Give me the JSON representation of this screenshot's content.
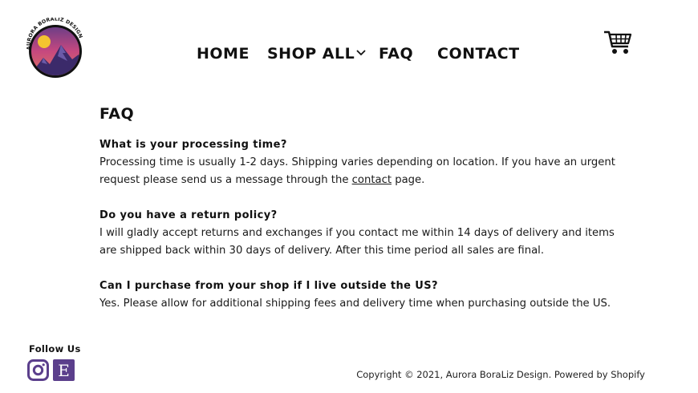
{
  "brand": {
    "logo_text": "AURORA BORALIZ DESIGN",
    "logo_colors": {
      "ring": "#111111",
      "sky_top": "#5b3f8c",
      "sky_mid": "#c6487f",
      "sun": "#f4c430",
      "mountain": "#3b2a6a"
    }
  },
  "nav": {
    "items": [
      {
        "label": "HOME"
      },
      {
        "label": "SHOP ALL"
      },
      {
        "label": "FAQ"
      },
      {
        "label": "CONTACT"
      }
    ],
    "cart_icon": "shopping-cart-icon"
  },
  "main": {
    "title": "FAQ",
    "faqs": [
      {
        "question": "What is your processing time?",
        "answer_before_link": "Processing time is usually 1-2 days. Shipping varies depending on location. If you have an urgent request please send us a message through the ",
        "link_text": "contact",
        "answer_after_link": " page."
      },
      {
        "question": "Do you have a return policy?",
        "answer": "I will gladly accept returns and exchanges if you contact me within 14 days of delivery and items are shipped back within 30 days of delivery. After this time period all sales are final."
      },
      {
        "question": "Can I purchase from your shop if I live outside the US?",
        "answer": "Yes. Please allow for additional shipping fees and delivery time when purchasing outside the US."
      }
    ]
  },
  "footer": {
    "follow_label": "Follow Us",
    "social": [
      {
        "icon": "instagram-icon",
        "color": "#5b3f8c"
      },
      {
        "icon": "etsy-icon",
        "letter": "E",
        "color": "#5b3f8c"
      }
    ],
    "copyright": "Copyright © 2021, Aurora BoraLiz Design. Powered by Shopify"
  }
}
